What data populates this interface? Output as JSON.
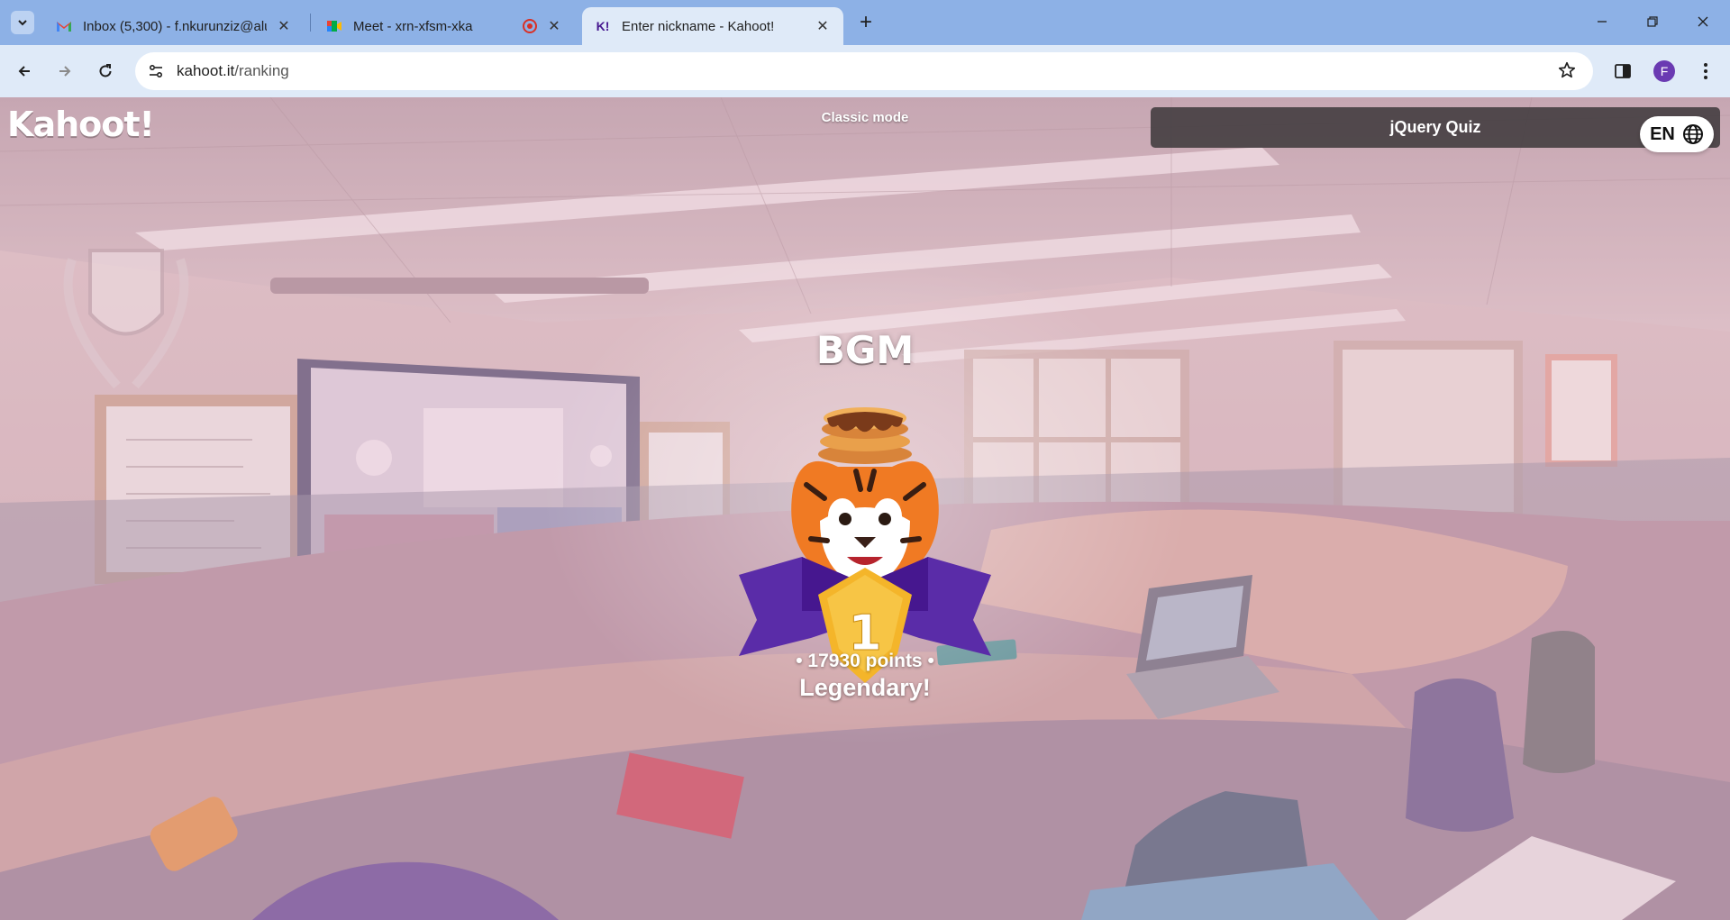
{
  "browser": {
    "tabs": [
      {
        "title": "Inbox (5,300) - f.nkurunziz@alu",
        "icon": "gmail-icon",
        "active": false
      },
      {
        "title": "Meet - xrn-xfsm-xka",
        "icon": "meet-icon",
        "active": false,
        "recording": true
      },
      {
        "title": "Enter nickname - Kahoot!",
        "icon": "kahoot-favicon",
        "favicon_text": "K!",
        "active": true
      }
    ],
    "new_tab_label": "+",
    "url_host": "kahoot.it",
    "url_path": "/ranking",
    "profile_initial": "F"
  },
  "game": {
    "logo_text": "Kahoot!",
    "mode": "Classic mode",
    "quiz_title": "jQuery Quiz",
    "language": "EN",
    "nickname": "BGM",
    "rank": "1",
    "points": "• 17930 points •",
    "verdict": "Legendary!"
  },
  "colors": {
    "tabbar": "#8db1e6",
    "toolbar": "#dfeaf8",
    "podium_purple": "#5a2ca8",
    "medal_gold": "#f4b52a"
  }
}
